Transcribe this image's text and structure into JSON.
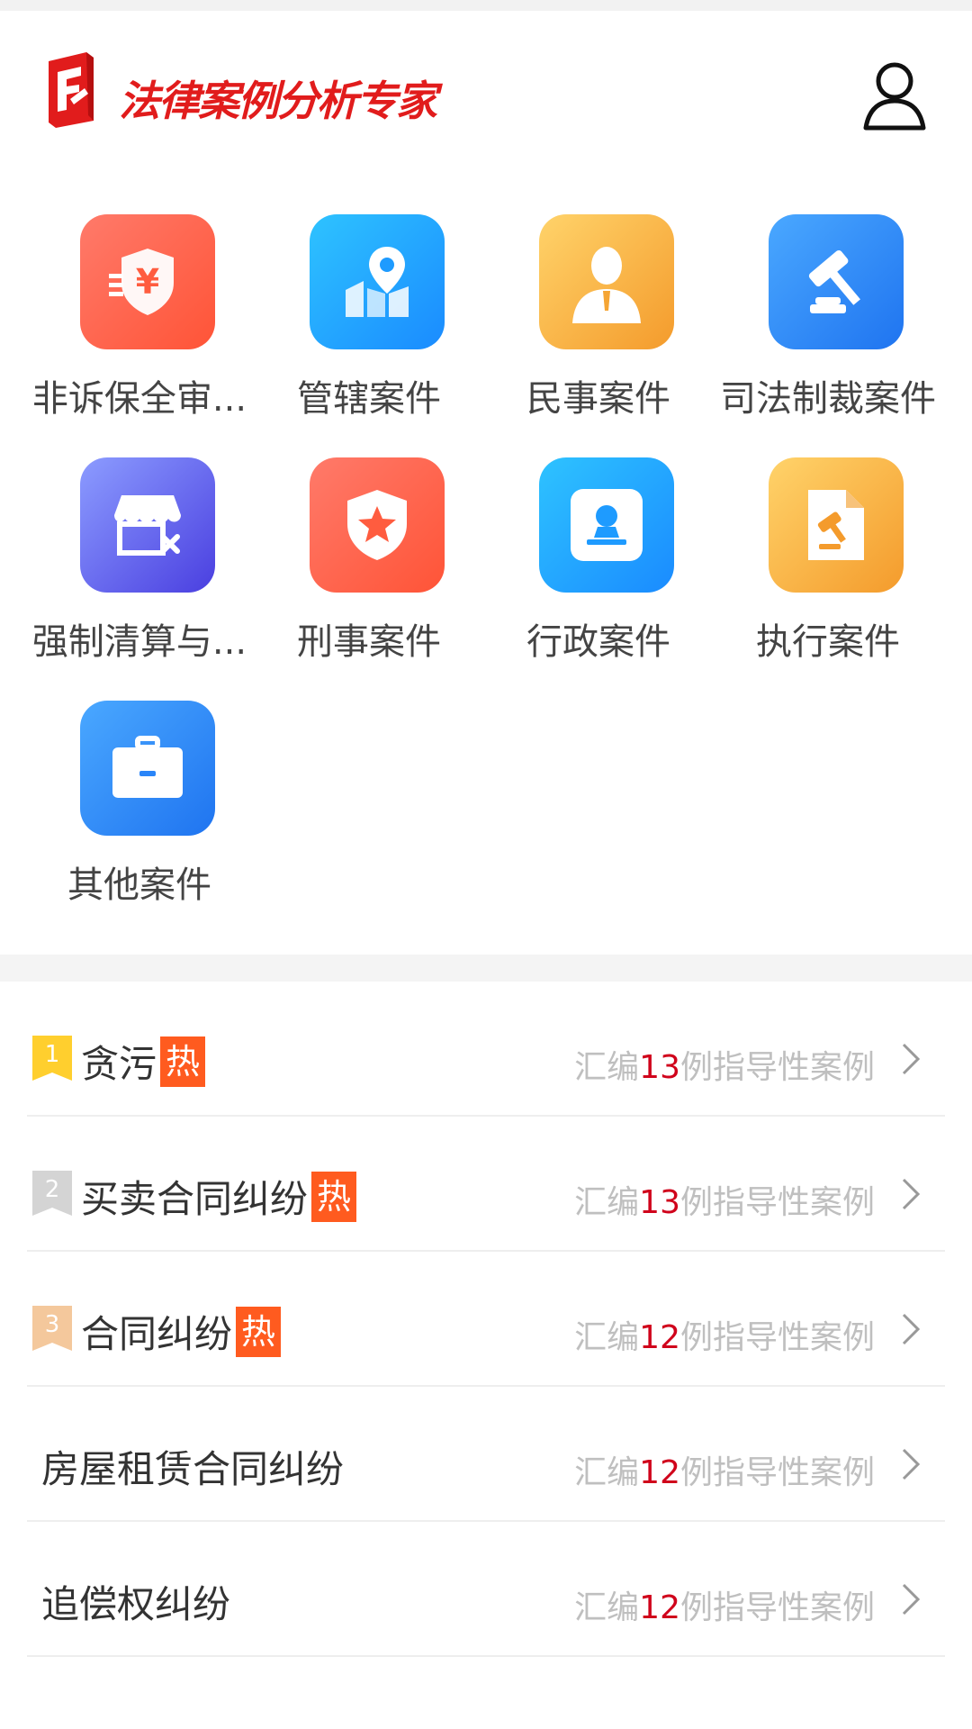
{
  "app": {
    "title": "法律案例分析专家"
  },
  "categories": [
    {
      "label": "非诉保全审...",
      "icon": "shield-yen-icon",
      "color": "#ff5c3f"
    },
    {
      "label": "管辖案件",
      "icon": "map-pin-icon",
      "color": "#1e9bff"
    },
    {
      "label": "民事案件",
      "icon": "person-icon",
      "color": "#f5a534"
    },
    {
      "label": "司法制裁案件",
      "icon": "gavel-icon",
      "color": "#2a85f8"
    },
    {
      "label": "强制清算与...",
      "icon": "store-closed-icon",
      "color": "#5a52e8"
    },
    {
      "label": "刑事案件",
      "icon": "shield-star-icon",
      "color": "#ff5c3f"
    },
    {
      "label": "行政案件",
      "icon": "stamp-icon",
      "color": "#1e9bff"
    },
    {
      "label": "执行案件",
      "icon": "document-gavel-icon",
      "color": "#f5a534"
    },
    {
      "label": "其他案件",
      "icon": "briefcase-icon",
      "color": "#2a85f8"
    }
  ],
  "ranking": [
    {
      "rank": "1",
      "title": "贪污",
      "hot": "热",
      "prefix": "汇编",
      "count": "13",
      "suffix": "例指导性案例"
    },
    {
      "rank": "2",
      "title": "买卖合同纠纷",
      "hot": "热",
      "prefix": "汇编",
      "count": "13",
      "suffix": "例指导性案例"
    },
    {
      "rank": "3",
      "title": "合同纠纷",
      "hot": "热",
      "prefix": "汇编",
      "count": "12",
      "suffix": "例指导性案例"
    },
    {
      "title": "房屋租赁合同纠纷",
      "prefix": "汇编",
      "count": "12",
      "suffix": "例指导性案例"
    },
    {
      "title": "追偿权纠纷",
      "prefix": "汇编",
      "count": "12",
      "suffix": "例指导性案例"
    }
  ]
}
